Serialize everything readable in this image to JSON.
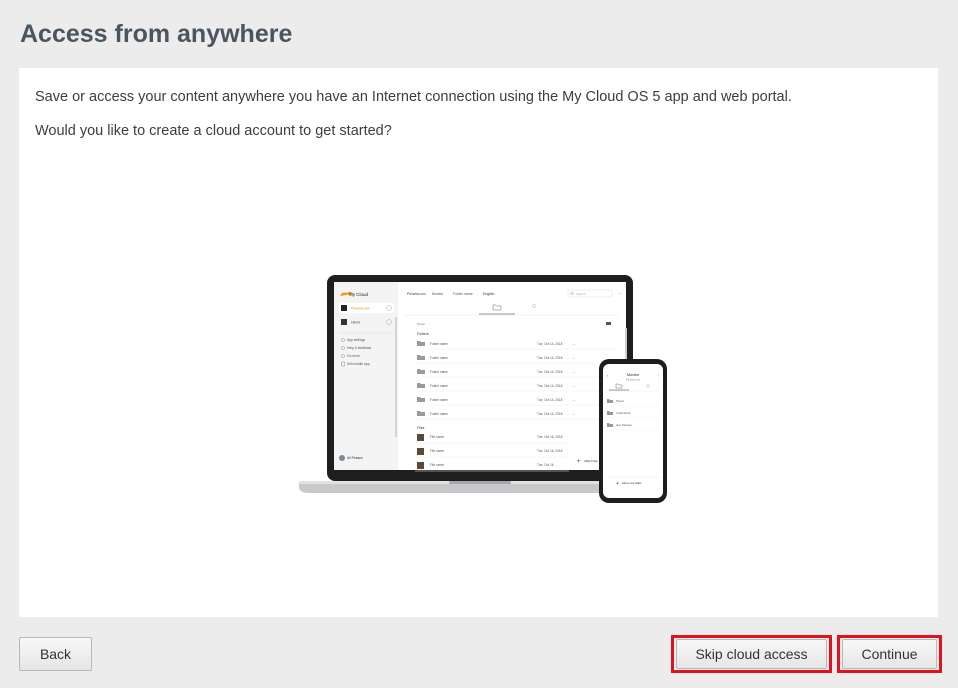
{
  "page": {
    "title": "Access from anywhere",
    "description": "Save or access your content anywhere you have an Internet connection using the My Cloud OS 5 app and web portal.",
    "question": "Would you like to create a cloud account to get started?"
  },
  "illustration": {
    "laptop": {
      "app_name": "My Cloud",
      "breadcrumb": [
        "Pa'amlo.xxx",
        "Movies",
        "Folder name",
        "English"
      ],
      "search_placeholder": "Search",
      "device_items": [
        "Pa'amlo.xxx",
        "Hibrid"
      ],
      "menu_items": [
        "App settings",
        "Help & feedback",
        "Go more",
        "Sell mobile app"
      ],
      "section_folders": "Folders",
      "section_files": "Files",
      "sort_label": "Name",
      "folder_rows": [
        {
          "name": "Folder name",
          "date": "Tue, Oct 14, 2018"
        },
        {
          "name": "Folder name",
          "date": "Tue, Oct 14, 2018"
        },
        {
          "name": "Folder name",
          "date": "Tue, Oct 14, 2018"
        },
        {
          "name": "Folder name",
          "date": "Tue, Oct 14, 2018"
        },
        {
          "name": "Folder name",
          "date": "Tue, Oct 14, 2018"
        },
        {
          "name": "Folder name",
          "date": "Tue, Oct 14, 2018"
        }
      ],
      "file_rows": [
        {
          "name": "File name",
          "date": "Tue, Oct 16, 2018"
        },
        {
          "name": "File name",
          "date": "Tue, Oct 16, 2018"
        },
        {
          "name": "File name",
          "date": "Tue, Oct 16"
        }
      ],
      "add_label": "ADD FILE",
      "user_name": "Ali Peasen"
    },
    "phone": {
      "title": "Movies",
      "subtitle": "Pa'amlo.xxx",
      "rows": [
        "Travel",
        "Underwhrld",
        "Hoo Passion"
      ],
      "add_label": "Add a new folder"
    }
  },
  "footer": {
    "back_label": "Back",
    "skip_label": "Skip cloud access",
    "continue_label": "Continue"
  },
  "colors": {
    "background": "#ececec",
    "panel": "#ffffff",
    "highlight": "#e0121c",
    "title": "#4a5560"
  }
}
